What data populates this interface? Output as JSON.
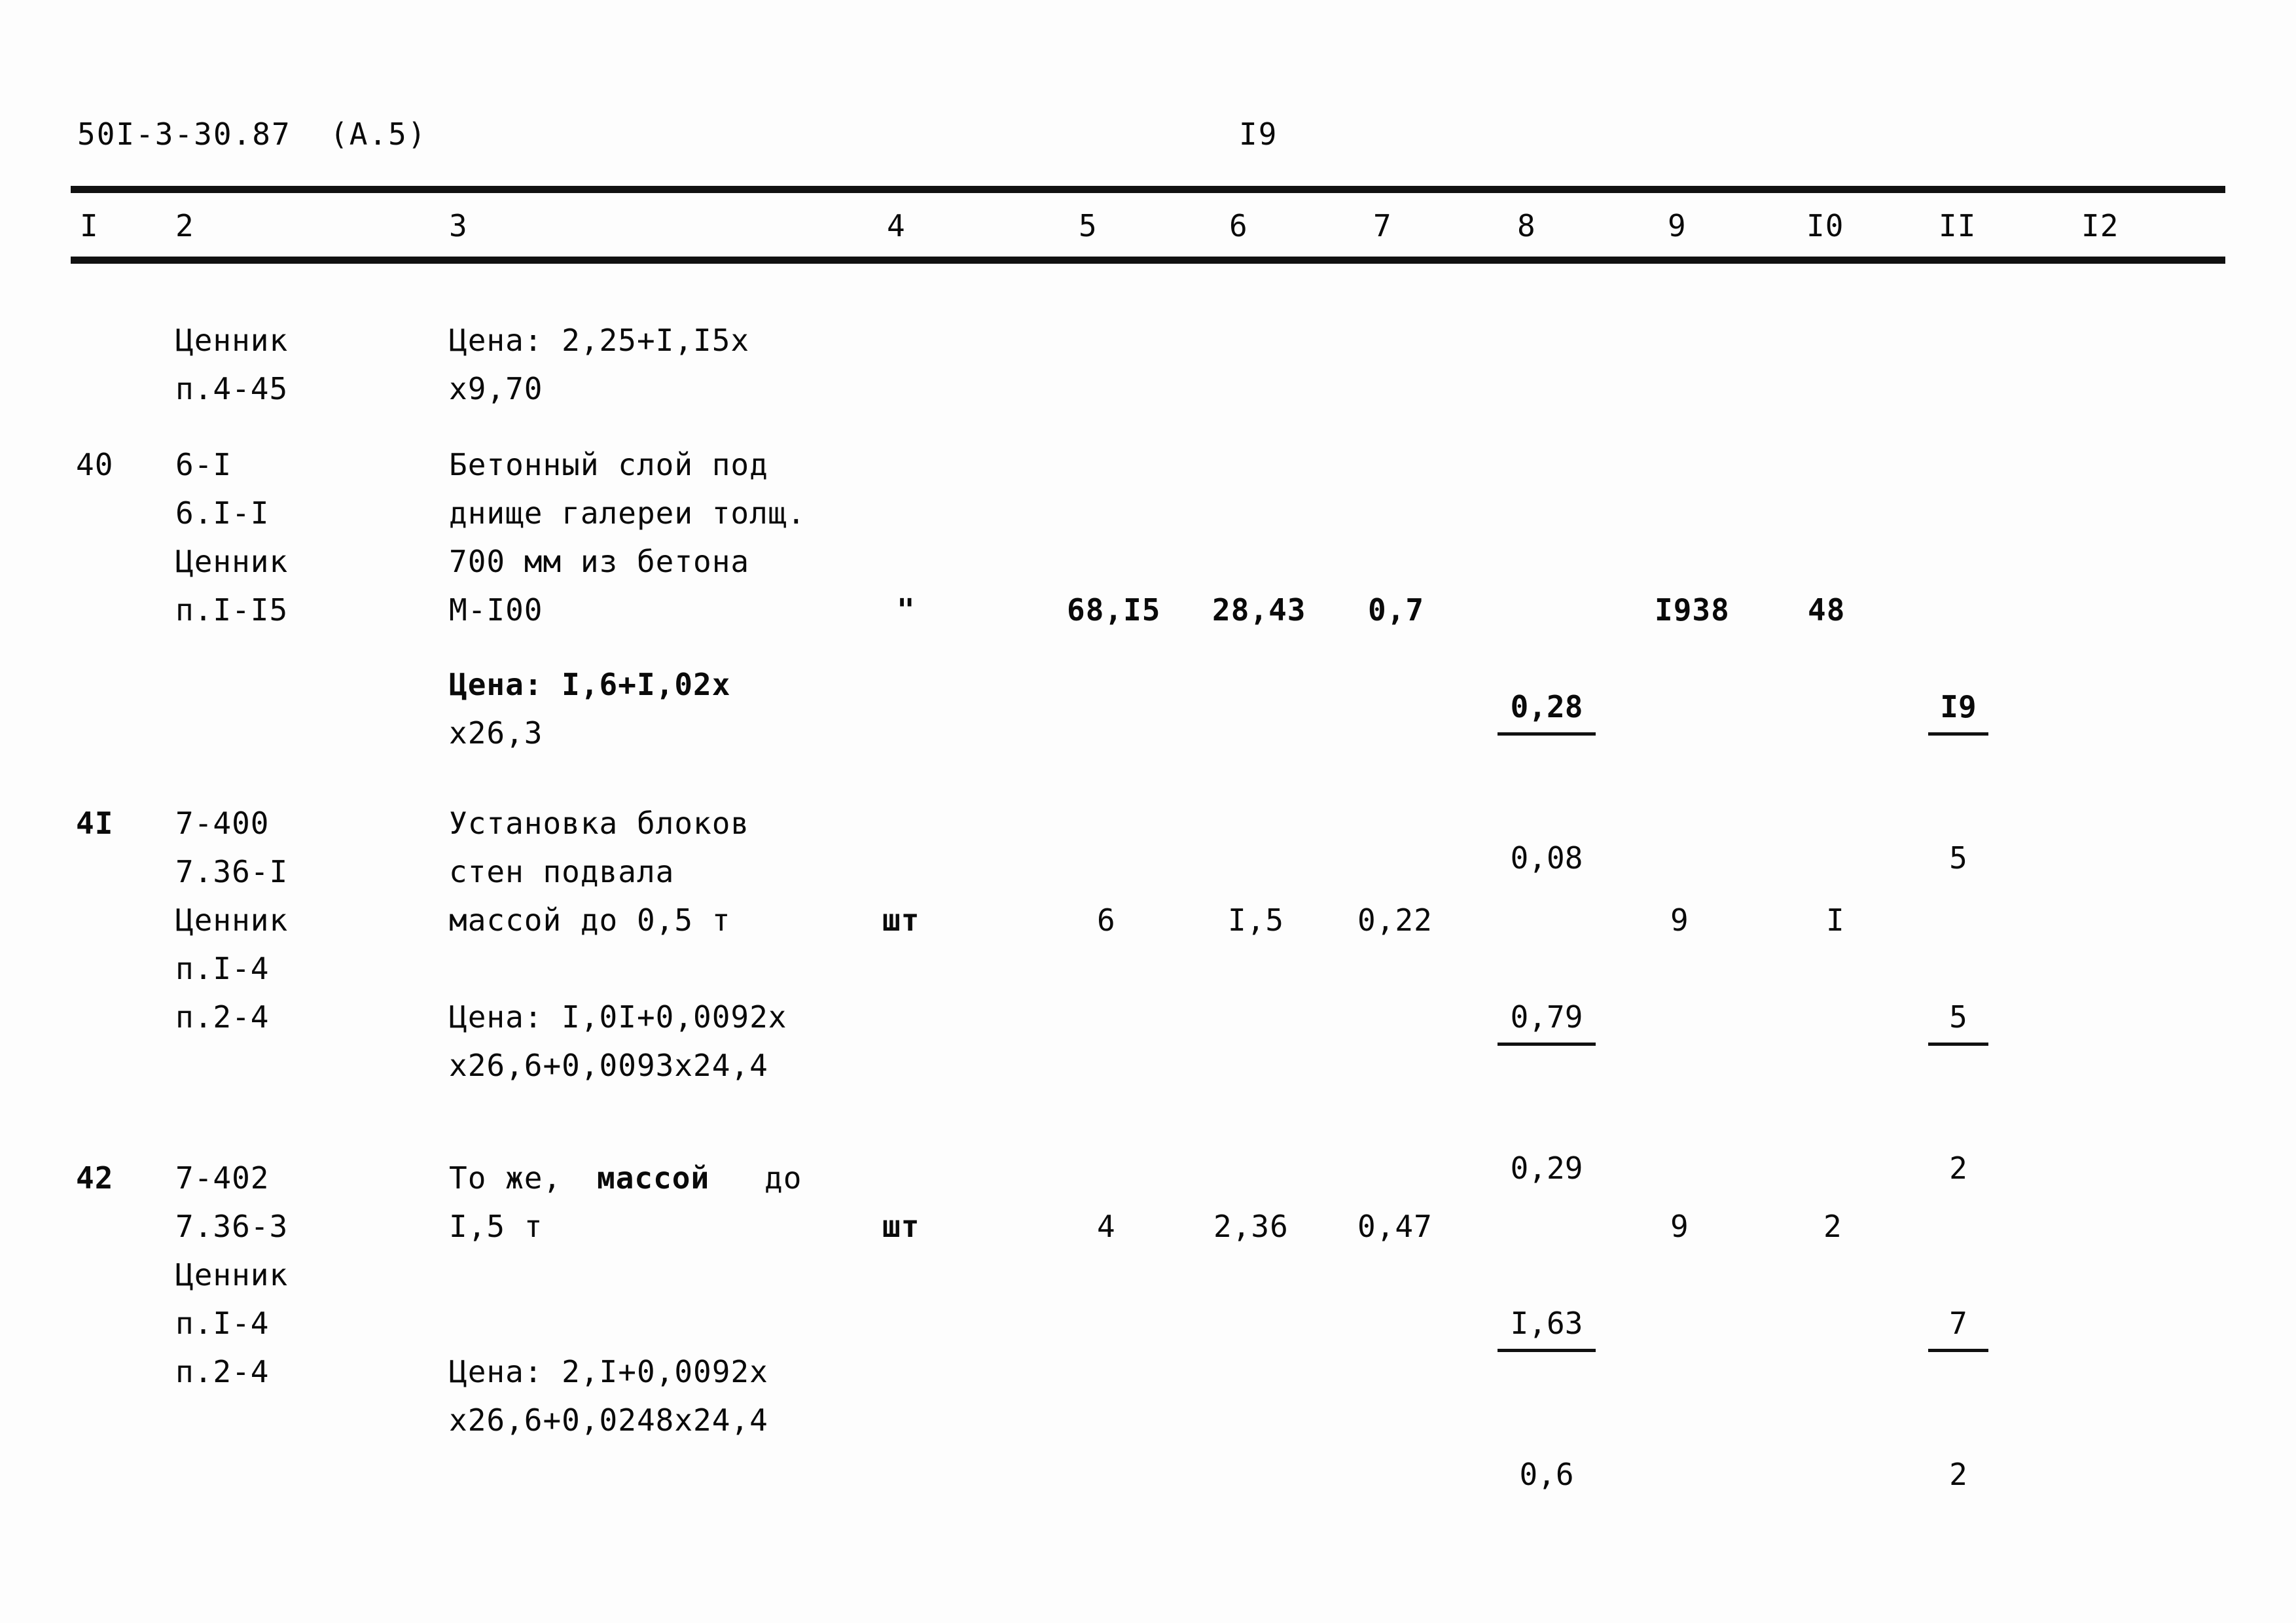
{
  "header": {
    "doc_code": "50I-3-30.87  (A.5)",
    "page_number": "I9"
  },
  "table": {
    "column_headers": [
      "I",
      "2",
      "3",
      "4",
      "5",
      "6",
      "7",
      "8",
      "9",
      "I0",
      "II",
      "I2"
    ],
    "blocks": [
      {
        "id": "block-pricelist-cont",
        "col1": "",
        "col2_lines": [
          "Ценник",
          "п.4-45"
        ],
        "col3_lines": [
          "Цена: 2,25+I,I5х",
          "х9,70"
        ],
        "col4": "",
        "col5": "",
        "col6": "",
        "col7": "",
        "col8_num": "",
        "col8_den": "",
        "col9": "",
        "col10": "",
        "col11_num": "",
        "col11_den": "",
        "col12": ""
      },
      {
        "id": "block-40",
        "col1": "40",
        "col2_lines": [
          "6-I",
          "6.I-I",
          "Ценник",
          "п.I-I5"
        ],
        "col3_lines": [
          "Бетонный слой под",
          "днище галереи толщ.",
          "700 мм из бетона",
          "М-I00"
        ],
        "col3_price_lines": [
          "Цена: I,6+I,02х",
          "х26,3"
        ],
        "col4": "\"",
        "col5": "68,I5",
        "col6": "28,43",
        "col7": "0,7",
        "col8_num": "0,28",
        "col8_den": "0,08",
        "col9": "I938",
        "col10": "48",
        "col11_num": "I9",
        "col11_den": "5",
        "col12": ""
      },
      {
        "id": "block-41",
        "col1": "4I",
        "col2_lines": [
          "7-400",
          "7.36-I",
          "Ценник",
          "п.I-4",
          "п.2-4"
        ],
        "col3_lines": [
          "Установка блоков",
          "стен подвала",
          "массой до 0,5 т"
        ],
        "col3_price_lines": [
          "Цена: I,0I+0,0092х",
          "х26,6+0,0093х24,4"
        ],
        "col4": "шт",
        "col5": "6",
        "col6": "I,5",
        "col7": "0,22",
        "col8_num": "0,79",
        "col8_den": "0,29",
        "col9": "9",
        "col10": "I",
        "col11_num": "5",
        "col11_den": "2",
        "col12": ""
      },
      {
        "id": "block-42",
        "col1": "42",
        "col2_lines": [
          "7-402",
          "7.36-3",
          "Ценник",
          "п.I-4",
          "п.2-4"
        ],
        "col3_line1_a": "То же,",
        "col3_line1_b": "массой",
        "col3_line1_c": "до",
        "col3_line2": "I,5 т",
        "col3_price_lines": [
          "Цена: 2,I+0,0092х",
          "х26,6+0,0248х24,4"
        ],
        "col4": "шт",
        "col5": "4",
        "col6": "2,36",
        "col7": "0,47",
        "col8_num": "I,63",
        "col8_den": "0,6",
        "col9": "9",
        "col10": "2",
        "col11_num": "7",
        "col11_den": "2",
        "col12": ""
      }
    ]
  }
}
